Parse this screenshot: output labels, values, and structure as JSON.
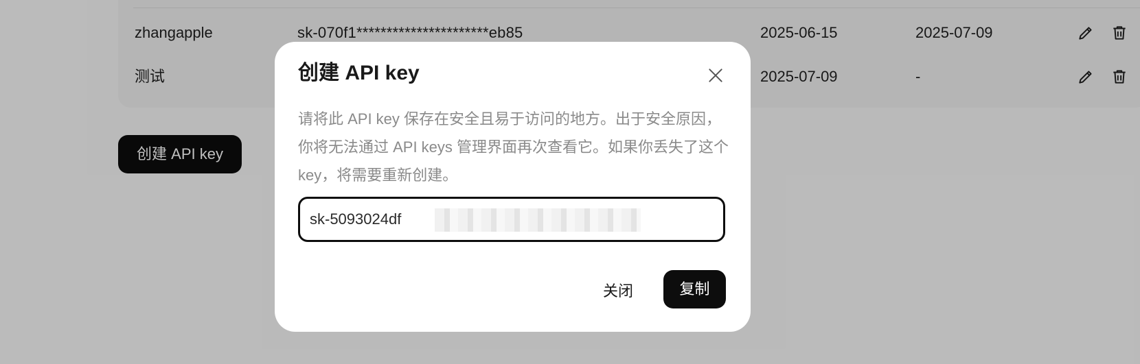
{
  "table": {
    "rows": [
      {
        "name": "zhangapple",
        "key": "sk-070f1**********************eb85",
        "created": "2025-06-15",
        "last_used": "2025-07-09"
      },
      {
        "name": "测试",
        "key": "",
        "created": "2025-07-09",
        "last_used": "-"
      }
    ]
  },
  "page": {
    "create_button_label": "创建 API key"
  },
  "modal": {
    "title": "创建 API key",
    "description": "请将此 API key 保存在安全且易于访问的地方。出于安全原因，你将无法通过 API keys 管理界面再次查看它。如果你丢失了这个 key，将需要重新创建。",
    "key_value_visible": "sk-5093024df",
    "key_value_tail": "8",
    "close_label": "关闭",
    "copy_label": "复制"
  },
  "icons": {
    "edit": "pencil-icon",
    "delete": "trash-icon",
    "close": "close-icon"
  },
  "colors": {
    "primary": "#0d0d0d",
    "overlay": "rgba(0,0,0,0.25)",
    "muted_text": "#8a8a8a"
  }
}
